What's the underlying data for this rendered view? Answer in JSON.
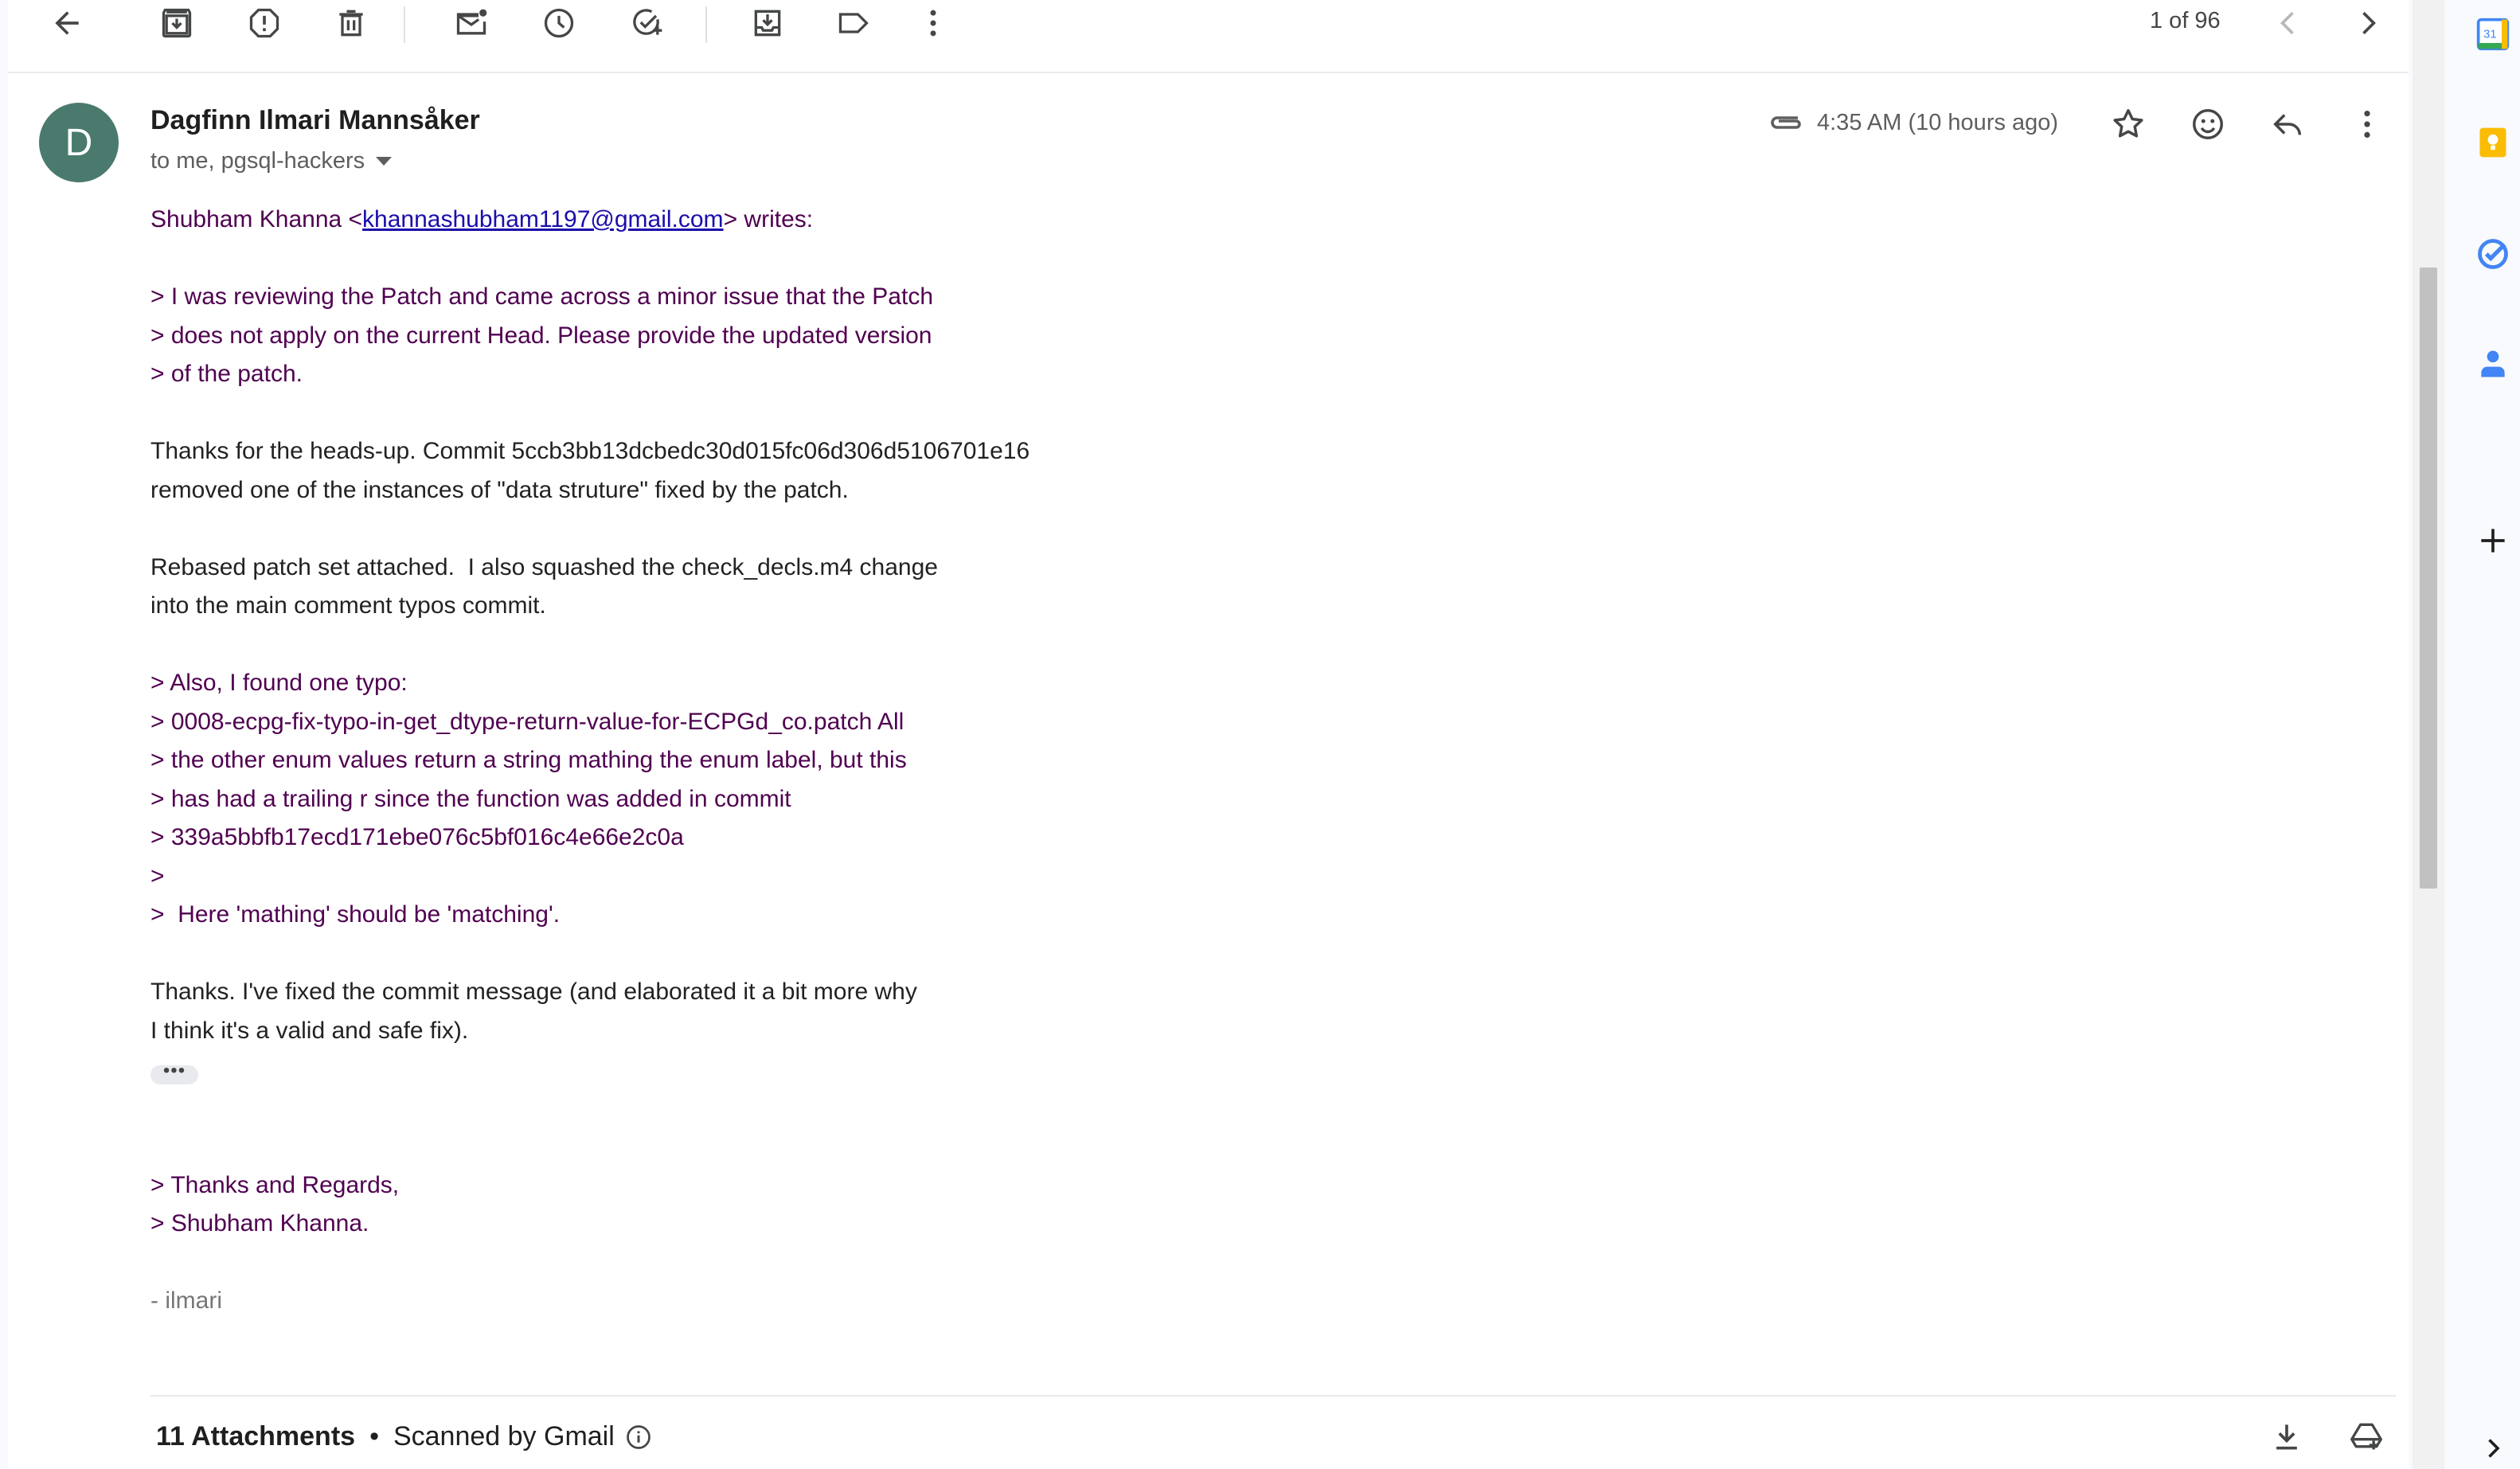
{
  "toolbar": {
    "pager_text": "1 of 96"
  },
  "message": {
    "avatar_letter": "D",
    "sender_name": "Dagfinn Ilmari Mannsåker",
    "recipients": "to me, pgsql-hackers",
    "time": "4:35 AM (10 hours ago)",
    "quote_intro_prefix": "Shubham Khanna <",
    "quote_intro_email": "khannashubham1197@gmail.com",
    "quote_intro_suffix": "> writes:",
    "lines": {
      "q1": "> I was reviewing the Patch and came across a minor issue that the Patch",
      "q2": "> does not apply on the current Head. Please provide the updated version",
      "q3": "> of the patch.",
      "p1": "Thanks for the heads-up. Commit 5ccb3bb13dcbedc30d015fc06d306d5106701e16",
      "p2": "removed one of the instances of \"data struture\" fixed by the patch.",
      "p3": "Rebased patch set attached.  I also squashed the check_decls.m4 change",
      "p4": "into the main comment typos commit.",
      "q4": "> Also, I found one typo:",
      "q5": "> 0008-ecpg-fix-typo-in-get_dtype-return-value-for-ECPGd_co.patch All",
      "q6": "> the other enum values return a string mathing the enum label, but this",
      "q7": "> has had a trailing r since the function was added in commit",
      "q8": "> 339a5bbfb17ecd171ebe076c5bf016c4e66e2c0a",
      "q9": ">",
      "q10": ">  Here 'mathing' should be 'matching'.",
      "p5": "Thanks. I've fixed the commit message (and elaborated it a bit more why",
      "p6": "I think it's a valid and safe fix).",
      "ellipsis": "•••",
      "q11": "> Thanks and Regards,",
      "q12": "> Shubham Khanna.",
      "sig": "- ilmari"
    }
  },
  "attachments": {
    "count_label": "11 Attachments",
    "bullet": "•",
    "scanned_label": "Scanned by Gmail"
  },
  "side_panel": {
    "calendar_day": "31"
  },
  "colors": {
    "quoted_text": "#500050",
    "avatar_bg": "#4a7a6d",
    "link": "#1a0dab"
  },
  "icons": [
    "back-arrow-icon",
    "archive-icon",
    "report-spam-icon",
    "delete-icon",
    "mark-unread-icon",
    "snooze-icon",
    "add-to-tasks-icon",
    "move-to-icon",
    "label-icon",
    "more-vert-icon",
    "chevron-left-icon",
    "chevron-right-icon",
    "attachment-clip-icon",
    "star-icon",
    "emoji-icon",
    "reply-icon",
    "download-icon",
    "save-to-drive-icon",
    "info-icon",
    "calendar-icon",
    "keep-icon",
    "tasks-icon",
    "contacts-icon",
    "add-icon"
  ]
}
